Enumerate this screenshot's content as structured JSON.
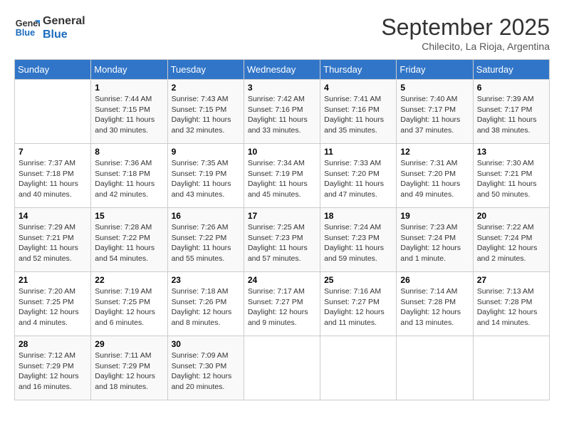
{
  "header": {
    "logo_line1": "General",
    "logo_line2": "Blue",
    "month": "September 2025",
    "location": "Chilecito, La Rioja, Argentina"
  },
  "days_of_week": [
    "Sunday",
    "Monday",
    "Tuesday",
    "Wednesday",
    "Thursday",
    "Friday",
    "Saturday"
  ],
  "weeks": [
    [
      {
        "day": "",
        "sunrise": "",
        "sunset": "",
        "daylight": ""
      },
      {
        "day": "1",
        "sunrise": "Sunrise: 7:44 AM",
        "sunset": "Sunset: 7:15 PM",
        "daylight": "Daylight: 11 hours and 30 minutes."
      },
      {
        "day": "2",
        "sunrise": "Sunrise: 7:43 AM",
        "sunset": "Sunset: 7:15 PM",
        "daylight": "Daylight: 11 hours and 32 minutes."
      },
      {
        "day": "3",
        "sunrise": "Sunrise: 7:42 AM",
        "sunset": "Sunset: 7:16 PM",
        "daylight": "Daylight: 11 hours and 33 minutes."
      },
      {
        "day": "4",
        "sunrise": "Sunrise: 7:41 AM",
        "sunset": "Sunset: 7:16 PM",
        "daylight": "Daylight: 11 hours and 35 minutes."
      },
      {
        "day": "5",
        "sunrise": "Sunrise: 7:40 AM",
        "sunset": "Sunset: 7:17 PM",
        "daylight": "Daylight: 11 hours and 37 minutes."
      },
      {
        "day": "6",
        "sunrise": "Sunrise: 7:39 AM",
        "sunset": "Sunset: 7:17 PM",
        "daylight": "Daylight: 11 hours and 38 minutes."
      }
    ],
    [
      {
        "day": "7",
        "sunrise": "Sunrise: 7:37 AM",
        "sunset": "Sunset: 7:18 PM",
        "daylight": "Daylight: 11 hours and 40 minutes."
      },
      {
        "day": "8",
        "sunrise": "Sunrise: 7:36 AM",
        "sunset": "Sunset: 7:18 PM",
        "daylight": "Daylight: 11 hours and 42 minutes."
      },
      {
        "day": "9",
        "sunrise": "Sunrise: 7:35 AM",
        "sunset": "Sunset: 7:19 PM",
        "daylight": "Daylight: 11 hours and 43 minutes."
      },
      {
        "day": "10",
        "sunrise": "Sunrise: 7:34 AM",
        "sunset": "Sunset: 7:19 PM",
        "daylight": "Daylight: 11 hours and 45 minutes."
      },
      {
        "day": "11",
        "sunrise": "Sunrise: 7:33 AM",
        "sunset": "Sunset: 7:20 PM",
        "daylight": "Daylight: 11 hours and 47 minutes."
      },
      {
        "day": "12",
        "sunrise": "Sunrise: 7:31 AM",
        "sunset": "Sunset: 7:20 PM",
        "daylight": "Daylight: 11 hours and 49 minutes."
      },
      {
        "day": "13",
        "sunrise": "Sunrise: 7:30 AM",
        "sunset": "Sunset: 7:21 PM",
        "daylight": "Daylight: 11 hours and 50 minutes."
      }
    ],
    [
      {
        "day": "14",
        "sunrise": "Sunrise: 7:29 AM",
        "sunset": "Sunset: 7:21 PM",
        "daylight": "Daylight: 11 hours and 52 minutes."
      },
      {
        "day": "15",
        "sunrise": "Sunrise: 7:28 AM",
        "sunset": "Sunset: 7:22 PM",
        "daylight": "Daylight: 11 hours and 54 minutes."
      },
      {
        "day": "16",
        "sunrise": "Sunrise: 7:26 AM",
        "sunset": "Sunset: 7:22 PM",
        "daylight": "Daylight: 11 hours and 55 minutes."
      },
      {
        "day": "17",
        "sunrise": "Sunrise: 7:25 AM",
        "sunset": "Sunset: 7:23 PM",
        "daylight": "Daylight: 11 hours and 57 minutes."
      },
      {
        "day": "18",
        "sunrise": "Sunrise: 7:24 AM",
        "sunset": "Sunset: 7:23 PM",
        "daylight": "Daylight: 11 hours and 59 minutes."
      },
      {
        "day": "19",
        "sunrise": "Sunrise: 7:23 AM",
        "sunset": "Sunset: 7:24 PM",
        "daylight": "Daylight: 12 hours and 1 minute."
      },
      {
        "day": "20",
        "sunrise": "Sunrise: 7:22 AM",
        "sunset": "Sunset: 7:24 PM",
        "daylight": "Daylight: 12 hours and 2 minutes."
      }
    ],
    [
      {
        "day": "21",
        "sunrise": "Sunrise: 7:20 AM",
        "sunset": "Sunset: 7:25 PM",
        "daylight": "Daylight: 12 hours and 4 minutes."
      },
      {
        "day": "22",
        "sunrise": "Sunrise: 7:19 AM",
        "sunset": "Sunset: 7:25 PM",
        "daylight": "Daylight: 12 hours and 6 minutes."
      },
      {
        "day": "23",
        "sunrise": "Sunrise: 7:18 AM",
        "sunset": "Sunset: 7:26 PM",
        "daylight": "Daylight: 12 hours and 8 minutes."
      },
      {
        "day": "24",
        "sunrise": "Sunrise: 7:17 AM",
        "sunset": "Sunset: 7:27 PM",
        "daylight": "Daylight: 12 hours and 9 minutes."
      },
      {
        "day": "25",
        "sunrise": "Sunrise: 7:16 AM",
        "sunset": "Sunset: 7:27 PM",
        "daylight": "Daylight: 12 hours and 11 minutes."
      },
      {
        "day": "26",
        "sunrise": "Sunrise: 7:14 AM",
        "sunset": "Sunset: 7:28 PM",
        "daylight": "Daylight: 12 hours and 13 minutes."
      },
      {
        "day": "27",
        "sunrise": "Sunrise: 7:13 AM",
        "sunset": "Sunset: 7:28 PM",
        "daylight": "Daylight: 12 hours and 14 minutes."
      }
    ],
    [
      {
        "day": "28",
        "sunrise": "Sunrise: 7:12 AM",
        "sunset": "Sunset: 7:29 PM",
        "daylight": "Daylight: 12 hours and 16 minutes."
      },
      {
        "day": "29",
        "sunrise": "Sunrise: 7:11 AM",
        "sunset": "Sunset: 7:29 PM",
        "daylight": "Daylight: 12 hours and 18 minutes."
      },
      {
        "day": "30",
        "sunrise": "Sunrise: 7:09 AM",
        "sunset": "Sunset: 7:30 PM",
        "daylight": "Daylight: 12 hours and 20 minutes."
      },
      {
        "day": "",
        "sunrise": "",
        "sunset": "",
        "daylight": ""
      },
      {
        "day": "",
        "sunrise": "",
        "sunset": "",
        "daylight": ""
      },
      {
        "day": "",
        "sunrise": "",
        "sunset": "",
        "daylight": ""
      },
      {
        "day": "",
        "sunrise": "",
        "sunset": "",
        "daylight": ""
      }
    ]
  ]
}
